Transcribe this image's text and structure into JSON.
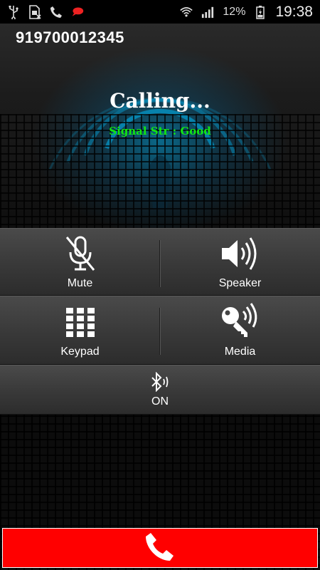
{
  "status_bar": {
    "icons_left": [
      "usb-icon",
      "sim-card-icon",
      "phone-call-icon",
      "chat-bubble-icon"
    ],
    "icons_right": [
      "wifi-icon",
      "cell-signal-icon",
      "battery-icon"
    ],
    "battery_percent": "12%",
    "time": "19:38"
  },
  "call": {
    "phone_number": "919700012345",
    "status": "Calling...",
    "signal": "Signal Str : Good"
  },
  "controls": {
    "mute_label": "Mute",
    "speaker_label": "Speaker",
    "keypad_label": "Keypad",
    "media_label": "Media",
    "bluetooth_label": "ON"
  },
  "colors": {
    "end_call": "#ff0000",
    "signal_text": "#12e812",
    "glow": "#00aae6"
  }
}
